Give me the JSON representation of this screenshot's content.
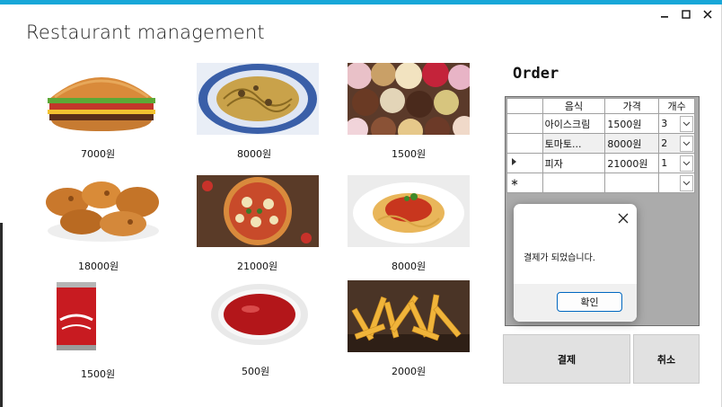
{
  "window": {
    "title": "Restaurant management",
    "accent_color": "#18a7d8",
    "controls": [
      "minimize-icon",
      "maximize-icon",
      "close-icon"
    ]
  },
  "menu": {
    "items": [
      {
        "name": "burger",
        "price": "7000원"
      },
      {
        "name": "pasta",
        "price": "8000원"
      },
      {
        "name": "ice-cream",
        "price": "1500원"
      },
      {
        "name": "fried-chicken",
        "price": "18000원"
      },
      {
        "name": "pizza",
        "price": "21000원"
      },
      {
        "name": "spaghetti",
        "price": "8000원"
      },
      {
        "name": "cola",
        "price": "1500원"
      },
      {
        "name": "sauce",
        "price": "500원"
      },
      {
        "name": "fries",
        "price": "2000원"
      }
    ]
  },
  "order": {
    "title": "Order",
    "columns": [
      "음식",
      "가격",
      "개수"
    ],
    "rows": [
      {
        "food": "아이스크림",
        "price": "1500원",
        "qty": "3"
      },
      {
        "food": "토마토...",
        "price": "8000원",
        "qty": "2"
      },
      {
        "food": "피자",
        "price": "21000원",
        "qty": "1"
      }
    ]
  },
  "dialog": {
    "message": "결제가 되었습니다.",
    "ok_label": "확인"
  },
  "buttons": {
    "pay": "결제",
    "cancel": "취소"
  }
}
